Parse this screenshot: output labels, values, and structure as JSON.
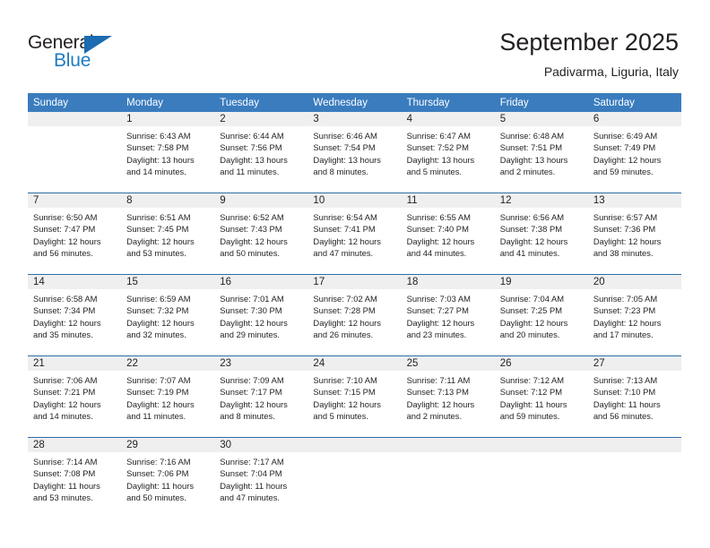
{
  "logo": {
    "word_one": "General",
    "word_two": "Blue",
    "triangle_icon": "triangle-icon",
    "brand_color": "#1f7bc1"
  },
  "header": {
    "title": "September 2025",
    "subtitle": "Padivarma, Liguria, Italy"
  },
  "theme": {
    "header_bg": "#3a7cbe",
    "header_text": "#ffffff",
    "daynum_bg": "#efefef",
    "row_divider": "#2e6da4",
    "body_text": "#231f20"
  },
  "calendar": {
    "weekday_headers": [
      "Sunday",
      "Monday",
      "Tuesday",
      "Wednesday",
      "Thursday",
      "Friday",
      "Saturday"
    ],
    "weeks": [
      [
        {
          "day": "",
          "empty": true,
          "lines": []
        },
        {
          "day": "1",
          "empty": false,
          "lines": [
            "Sunrise: 6:43 AM",
            "Sunset: 7:58 PM",
            "Daylight: 13 hours",
            "and 14 minutes."
          ]
        },
        {
          "day": "2",
          "empty": false,
          "lines": [
            "Sunrise: 6:44 AM",
            "Sunset: 7:56 PM",
            "Daylight: 13 hours",
            "and 11 minutes."
          ]
        },
        {
          "day": "3",
          "empty": false,
          "lines": [
            "Sunrise: 6:46 AM",
            "Sunset: 7:54 PM",
            "Daylight: 13 hours",
            "and 8 minutes."
          ]
        },
        {
          "day": "4",
          "empty": false,
          "lines": [
            "Sunrise: 6:47 AM",
            "Sunset: 7:52 PM",
            "Daylight: 13 hours",
            "and 5 minutes."
          ]
        },
        {
          "day": "5",
          "empty": false,
          "lines": [
            "Sunrise: 6:48 AM",
            "Sunset: 7:51 PM",
            "Daylight: 13 hours",
            "and 2 minutes."
          ]
        },
        {
          "day": "6",
          "empty": false,
          "lines": [
            "Sunrise: 6:49 AM",
            "Sunset: 7:49 PM",
            "Daylight: 12 hours",
            "and 59 minutes."
          ]
        }
      ],
      [
        {
          "day": "7",
          "empty": false,
          "lines": [
            "Sunrise: 6:50 AM",
            "Sunset: 7:47 PM",
            "Daylight: 12 hours",
            "and 56 minutes."
          ]
        },
        {
          "day": "8",
          "empty": false,
          "lines": [
            "Sunrise: 6:51 AM",
            "Sunset: 7:45 PM",
            "Daylight: 12 hours",
            "and 53 minutes."
          ]
        },
        {
          "day": "9",
          "empty": false,
          "lines": [
            "Sunrise: 6:52 AM",
            "Sunset: 7:43 PM",
            "Daylight: 12 hours",
            "and 50 minutes."
          ]
        },
        {
          "day": "10",
          "empty": false,
          "lines": [
            "Sunrise: 6:54 AM",
            "Sunset: 7:41 PM",
            "Daylight: 12 hours",
            "and 47 minutes."
          ]
        },
        {
          "day": "11",
          "empty": false,
          "lines": [
            "Sunrise: 6:55 AM",
            "Sunset: 7:40 PM",
            "Daylight: 12 hours",
            "and 44 minutes."
          ]
        },
        {
          "day": "12",
          "empty": false,
          "lines": [
            "Sunrise: 6:56 AM",
            "Sunset: 7:38 PM",
            "Daylight: 12 hours",
            "and 41 minutes."
          ]
        },
        {
          "day": "13",
          "empty": false,
          "lines": [
            "Sunrise: 6:57 AM",
            "Sunset: 7:36 PM",
            "Daylight: 12 hours",
            "and 38 minutes."
          ]
        }
      ],
      [
        {
          "day": "14",
          "empty": false,
          "lines": [
            "Sunrise: 6:58 AM",
            "Sunset: 7:34 PM",
            "Daylight: 12 hours",
            "and 35 minutes."
          ]
        },
        {
          "day": "15",
          "empty": false,
          "lines": [
            "Sunrise: 6:59 AM",
            "Sunset: 7:32 PM",
            "Daylight: 12 hours",
            "and 32 minutes."
          ]
        },
        {
          "day": "16",
          "empty": false,
          "lines": [
            "Sunrise: 7:01 AM",
            "Sunset: 7:30 PM",
            "Daylight: 12 hours",
            "and 29 minutes."
          ]
        },
        {
          "day": "17",
          "empty": false,
          "lines": [
            "Sunrise: 7:02 AM",
            "Sunset: 7:28 PM",
            "Daylight: 12 hours",
            "and 26 minutes."
          ]
        },
        {
          "day": "18",
          "empty": false,
          "lines": [
            "Sunrise: 7:03 AM",
            "Sunset: 7:27 PM",
            "Daylight: 12 hours",
            "and 23 minutes."
          ]
        },
        {
          "day": "19",
          "empty": false,
          "lines": [
            "Sunrise: 7:04 AM",
            "Sunset: 7:25 PM",
            "Daylight: 12 hours",
            "and 20 minutes."
          ]
        },
        {
          "day": "20",
          "empty": false,
          "lines": [
            "Sunrise: 7:05 AM",
            "Sunset: 7:23 PM",
            "Daylight: 12 hours",
            "and 17 minutes."
          ]
        }
      ],
      [
        {
          "day": "21",
          "empty": false,
          "lines": [
            "Sunrise: 7:06 AM",
            "Sunset: 7:21 PM",
            "Daylight: 12 hours",
            "and 14 minutes."
          ]
        },
        {
          "day": "22",
          "empty": false,
          "lines": [
            "Sunrise: 7:07 AM",
            "Sunset: 7:19 PM",
            "Daylight: 12 hours",
            "and 11 minutes."
          ]
        },
        {
          "day": "23",
          "empty": false,
          "lines": [
            "Sunrise: 7:09 AM",
            "Sunset: 7:17 PM",
            "Daylight: 12 hours",
            "and 8 minutes."
          ]
        },
        {
          "day": "24",
          "empty": false,
          "lines": [
            "Sunrise: 7:10 AM",
            "Sunset: 7:15 PM",
            "Daylight: 12 hours",
            "and 5 minutes."
          ]
        },
        {
          "day": "25",
          "empty": false,
          "lines": [
            "Sunrise: 7:11 AM",
            "Sunset: 7:13 PM",
            "Daylight: 12 hours",
            "and 2 minutes."
          ]
        },
        {
          "day": "26",
          "empty": false,
          "lines": [
            "Sunrise: 7:12 AM",
            "Sunset: 7:12 PM",
            "Daylight: 11 hours",
            "and 59 minutes."
          ]
        },
        {
          "day": "27",
          "empty": false,
          "lines": [
            "Sunrise: 7:13 AM",
            "Sunset: 7:10 PM",
            "Daylight: 11 hours",
            "and 56 minutes."
          ]
        }
      ],
      [
        {
          "day": "28",
          "empty": false,
          "lines": [
            "Sunrise: 7:14 AM",
            "Sunset: 7:08 PM",
            "Daylight: 11 hours",
            "and 53 minutes."
          ]
        },
        {
          "day": "29",
          "empty": false,
          "lines": [
            "Sunrise: 7:16 AM",
            "Sunset: 7:06 PM",
            "Daylight: 11 hours",
            "and 50 minutes."
          ]
        },
        {
          "day": "30",
          "empty": false,
          "lines": [
            "Sunrise: 7:17 AM",
            "Sunset: 7:04 PM",
            "Daylight: 11 hours",
            "and 47 minutes."
          ]
        },
        {
          "day": "",
          "empty": true,
          "lines": []
        },
        {
          "day": "",
          "empty": true,
          "lines": []
        },
        {
          "day": "",
          "empty": true,
          "lines": []
        },
        {
          "day": "",
          "empty": true,
          "lines": []
        }
      ]
    ]
  }
}
